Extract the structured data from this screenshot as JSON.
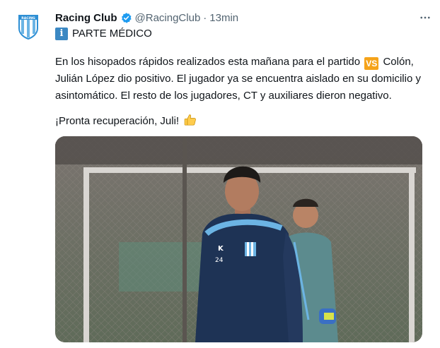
{
  "tweet": {
    "display_name": "Racing Club",
    "handle": "@RacingClub",
    "separator": "·",
    "time": "13min",
    "headline_emoji": "i",
    "headline": "PARTE MÉDICO",
    "body_before_vs": "En los hisopados rápidos realizados esta mañana para el partido ",
    "vs_emoji": "VS",
    "body_after_vs": " Colón, Julián López dio positivo. El jugador ya se encuentra aislado en su domicilio y asintomático. El resto de los jugadores, CT y auxiliares dieron negativo.",
    "closing": "¡Pronta recuperación, Juli!",
    "icons": {
      "avatar": "racing-club-crest",
      "verified": "verified-badge-icon",
      "more": "more-options-icon",
      "thumbs": "thumbs-up-icon"
    },
    "media_alt": "photo of two Racing Club players at training"
  },
  "colors": {
    "primary_text": "#0f1419",
    "secondary_text": "#536471",
    "verified_blue": "#1d9bf0",
    "racing_light_blue": "#6cb4e4",
    "info_blue": "#3b88c3",
    "vs_orange": "#f5a31a"
  }
}
